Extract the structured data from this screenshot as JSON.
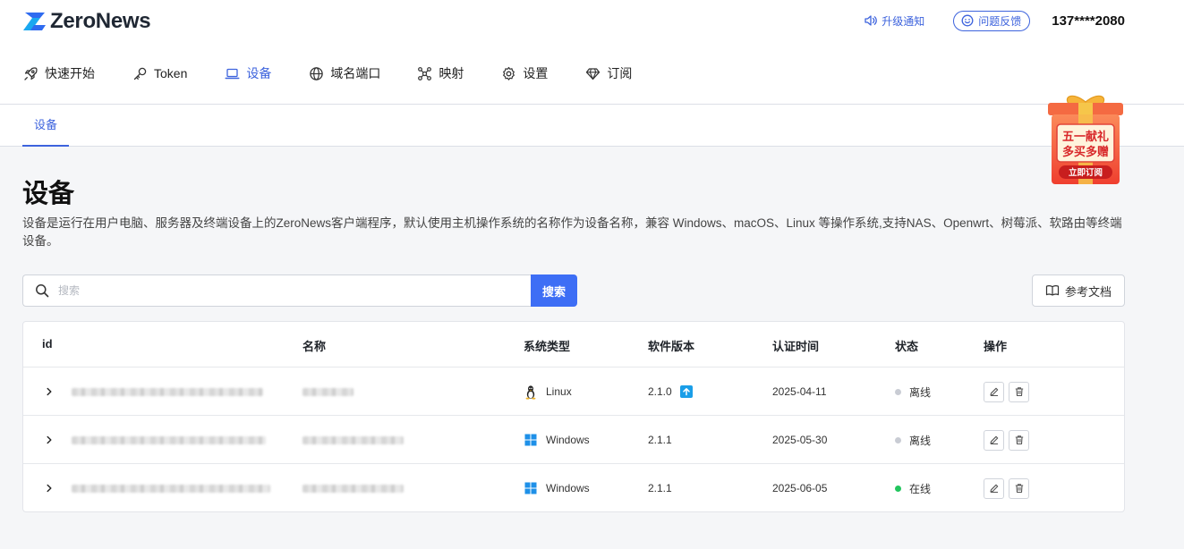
{
  "brand": {
    "name": "ZeroNews"
  },
  "header": {
    "notify_label": "升级通知",
    "feedback_label": "问题反馈",
    "user_phone": "137****2080"
  },
  "nav": [
    {
      "label": "快速开始",
      "icon": "rocket-icon",
      "active": false
    },
    {
      "label": "Token",
      "icon": "key-icon",
      "active": false
    },
    {
      "label": "设备",
      "icon": "laptop-icon",
      "active": true
    },
    {
      "label": "域名端口",
      "icon": "globe-icon",
      "active": false
    },
    {
      "label": "映射",
      "icon": "network-icon",
      "active": false
    },
    {
      "label": "设置",
      "icon": "gear-icon",
      "active": false
    },
    {
      "label": "订阅",
      "icon": "diamond-icon",
      "active": false
    }
  ],
  "subtab": {
    "label": "设备"
  },
  "promo": {
    "line1": "五一献礼",
    "line2": "多买多赠",
    "button": "立即订阅"
  },
  "page": {
    "title": "设备",
    "description": "设备是运行在用户电脑、服务器及终端设备上的ZeroNews客户端程序，默认使用主机操作系统的名称作为设备名称，兼容 Windows、macOS、Linux 等操作系统,支持NAS、Openwrt、树莓派、软路由等终端设备。"
  },
  "search": {
    "placeholder": "搜索",
    "button": "搜索"
  },
  "docs_button": {
    "label": "参考文档"
  },
  "table": {
    "columns": {
      "id": "id",
      "name": "名称",
      "os": "系统类型",
      "version": "软件版本",
      "auth_time": "认证时间",
      "status": "状态",
      "actions": "操作"
    },
    "rows": [
      {
        "os": "Linux",
        "os_icon": "linux-icon",
        "version": "2.1.0",
        "has_upgrade": true,
        "auth_time": "2025-04-11",
        "status": "离线",
        "online": false
      },
      {
        "os": "Windows",
        "os_icon": "windows-icon",
        "version": "2.1.1",
        "has_upgrade": false,
        "auth_time": "2025-05-30",
        "status": "离线",
        "online": false
      },
      {
        "os": "Windows",
        "os_icon": "windows-icon",
        "version": "2.1.1",
        "has_upgrade": false,
        "auth_time": "2025-06-05",
        "status": "在线",
        "online": true
      }
    ]
  },
  "colors": {
    "accent": "#3d63dd",
    "primary_button": "#3d6ef5",
    "online": "#22c55e",
    "offline": "#c9ccd4",
    "upgrade_badge": "#1a9ee8"
  }
}
